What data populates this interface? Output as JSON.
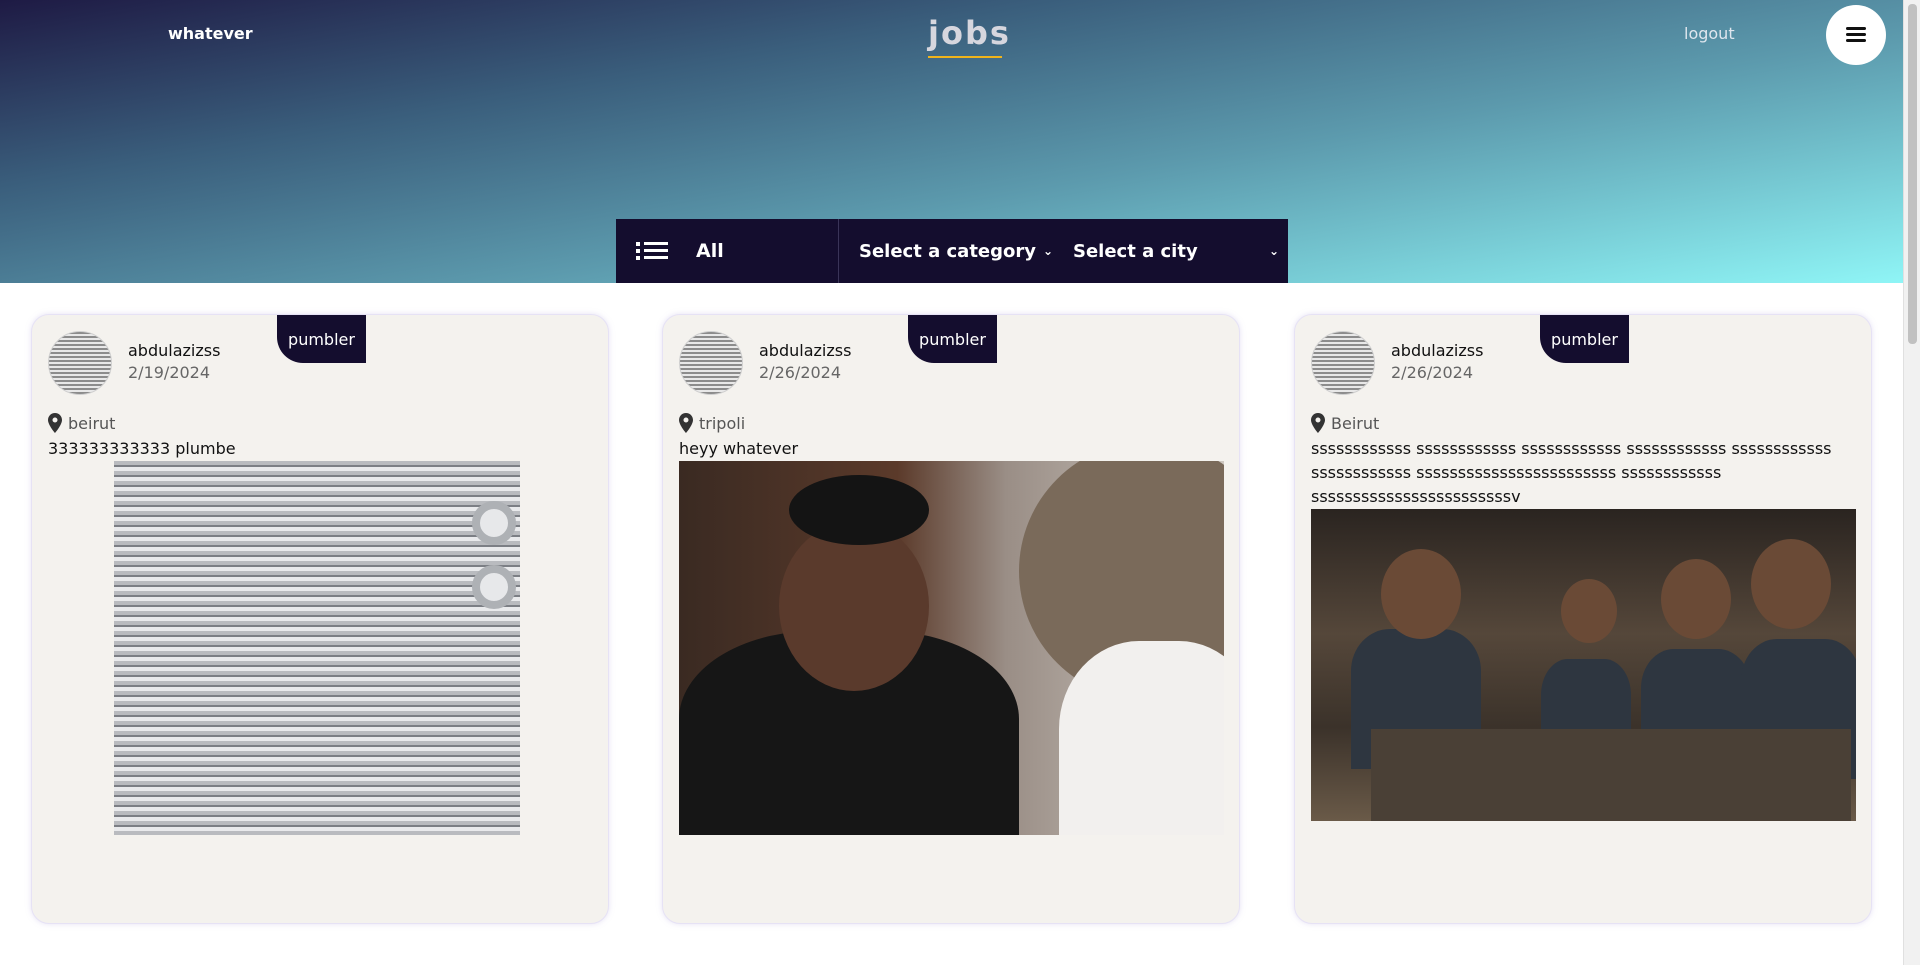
{
  "header": {
    "left_title": "whatever",
    "logo": "jobs",
    "logout": "logout",
    "menu_icon": "hamburger-icon"
  },
  "filter": {
    "all_label": "All",
    "category_placeholder": "Select a category",
    "city_placeholder": "Select a city"
  },
  "posts": [
    {
      "badge": "pumbler",
      "username": "abdulazizss",
      "date": "2/19/2024",
      "location": "beirut",
      "description": "333333333333 plumbe",
      "image": "radiator"
    },
    {
      "badge": "pumbler",
      "username": "abdulazizss",
      "date": "2/26/2024",
      "location": "tripoli",
      "description": "heyy whatever",
      "image": "interview"
    },
    {
      "badge": "pumbler",
      "username": "abdulazizss",
      "date": "2/26/2024",
      "location": "Beirut",
      "description": "ssssssssssss ssssssssssss ssssssssssss ssssssssssss ssssssssssss ssssssssssss ssssssssssssssssssssssss ssssssssssss ssssssssssssssssssssssssv",
      "image": "workshop"
    }
  ],
  "colors": {
    "accent": "#f0b41b",
    "navy": "#140d2e",
    "card_bg": "#f4f2ee"
  }
}
